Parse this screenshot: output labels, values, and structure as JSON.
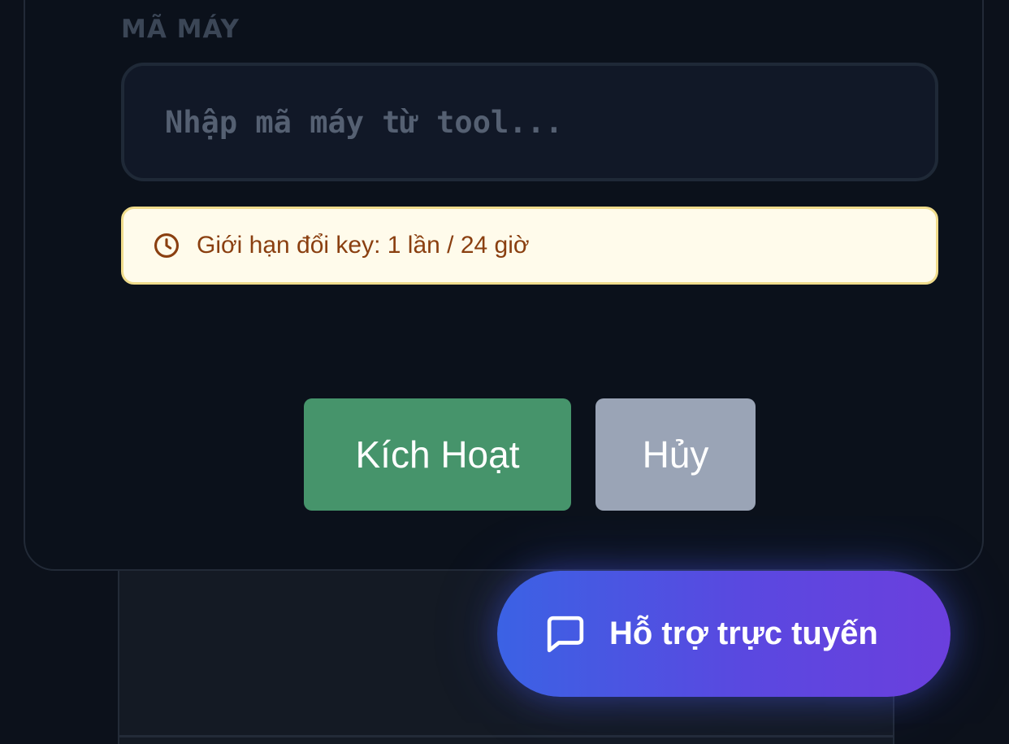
{
  "form": {
    "machine_code_label": "MÃ MÁY",
    "machine_code_value": "",
    "machine_code_placeholder": "Nhập mã máy từ tool..."
  },
  "notice": {
    "icon": "clock-icon",
    "text": "Giới hạn đổi key: 1 lần / 24 giờ"
  },
  "actions": {
    "activate_label": "Kích Hoạt",
    "cancel_label": "Hủy"
  },
  "support": {
    "icon": "chat-bubble-icon",
    "label": "Hỗ trợ trực tuyến"
  },
  "colors": {
    "background": "#0c111b",
    "activate_button": "#46946b",
    "cancel_button": "#9aa4b6",
    "notice_bg": "#fffbeb",
    "notice_text": "#8a3f10",
    "support_gradient_start": "#3b62e4",
    "support_gradient_end": "#6b3fdd"
  }
}
